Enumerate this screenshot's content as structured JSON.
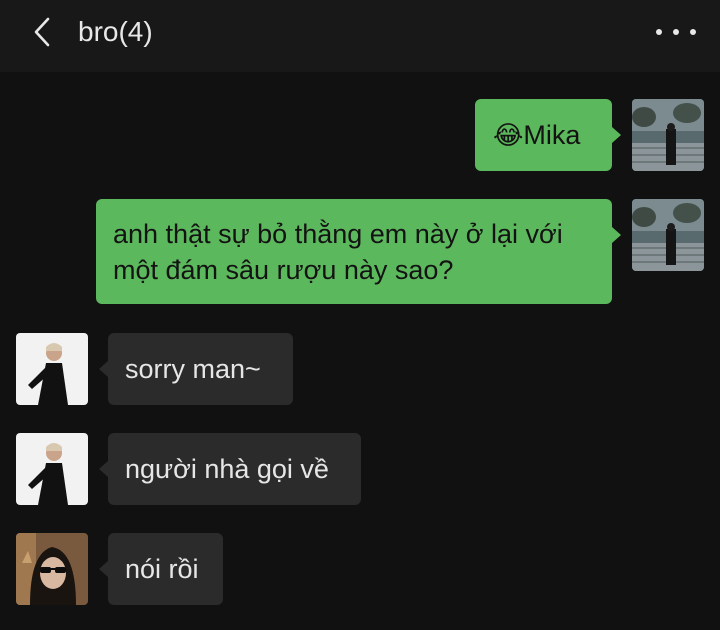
{
  "header": {
    "title": "bro(4)",
    "back_icon": "chevron-left-icon",
    "more_icon": "more-horizontal-icon"
  },
  "colors": {
    "background": "#111111",
    "header_bg": "#181818",
    "outgoing_bubble": "#5cb85c",
    "incoming_bubble": "#2b2b2b"
  },
  "messages": [
    {
      "direction": "outgoing",
      "emoji": "😂",
      "text": "Mika"
    },
    {
      "direction": "outgoing",
      "lines": [
        "anh thật sự bỏ thằng em này ở lại với",
        "một đám sâu rượu này sao?"
      ]
    },
    {
      "direction": "incoming",
      "text": "sorry man~"
    },
    {
      "direction": "incoming",
      "text": "người nhà gọi về"
    },
    {
      "direction": "incoming",
      "text": "nói rồi"
    }
  ]
}
